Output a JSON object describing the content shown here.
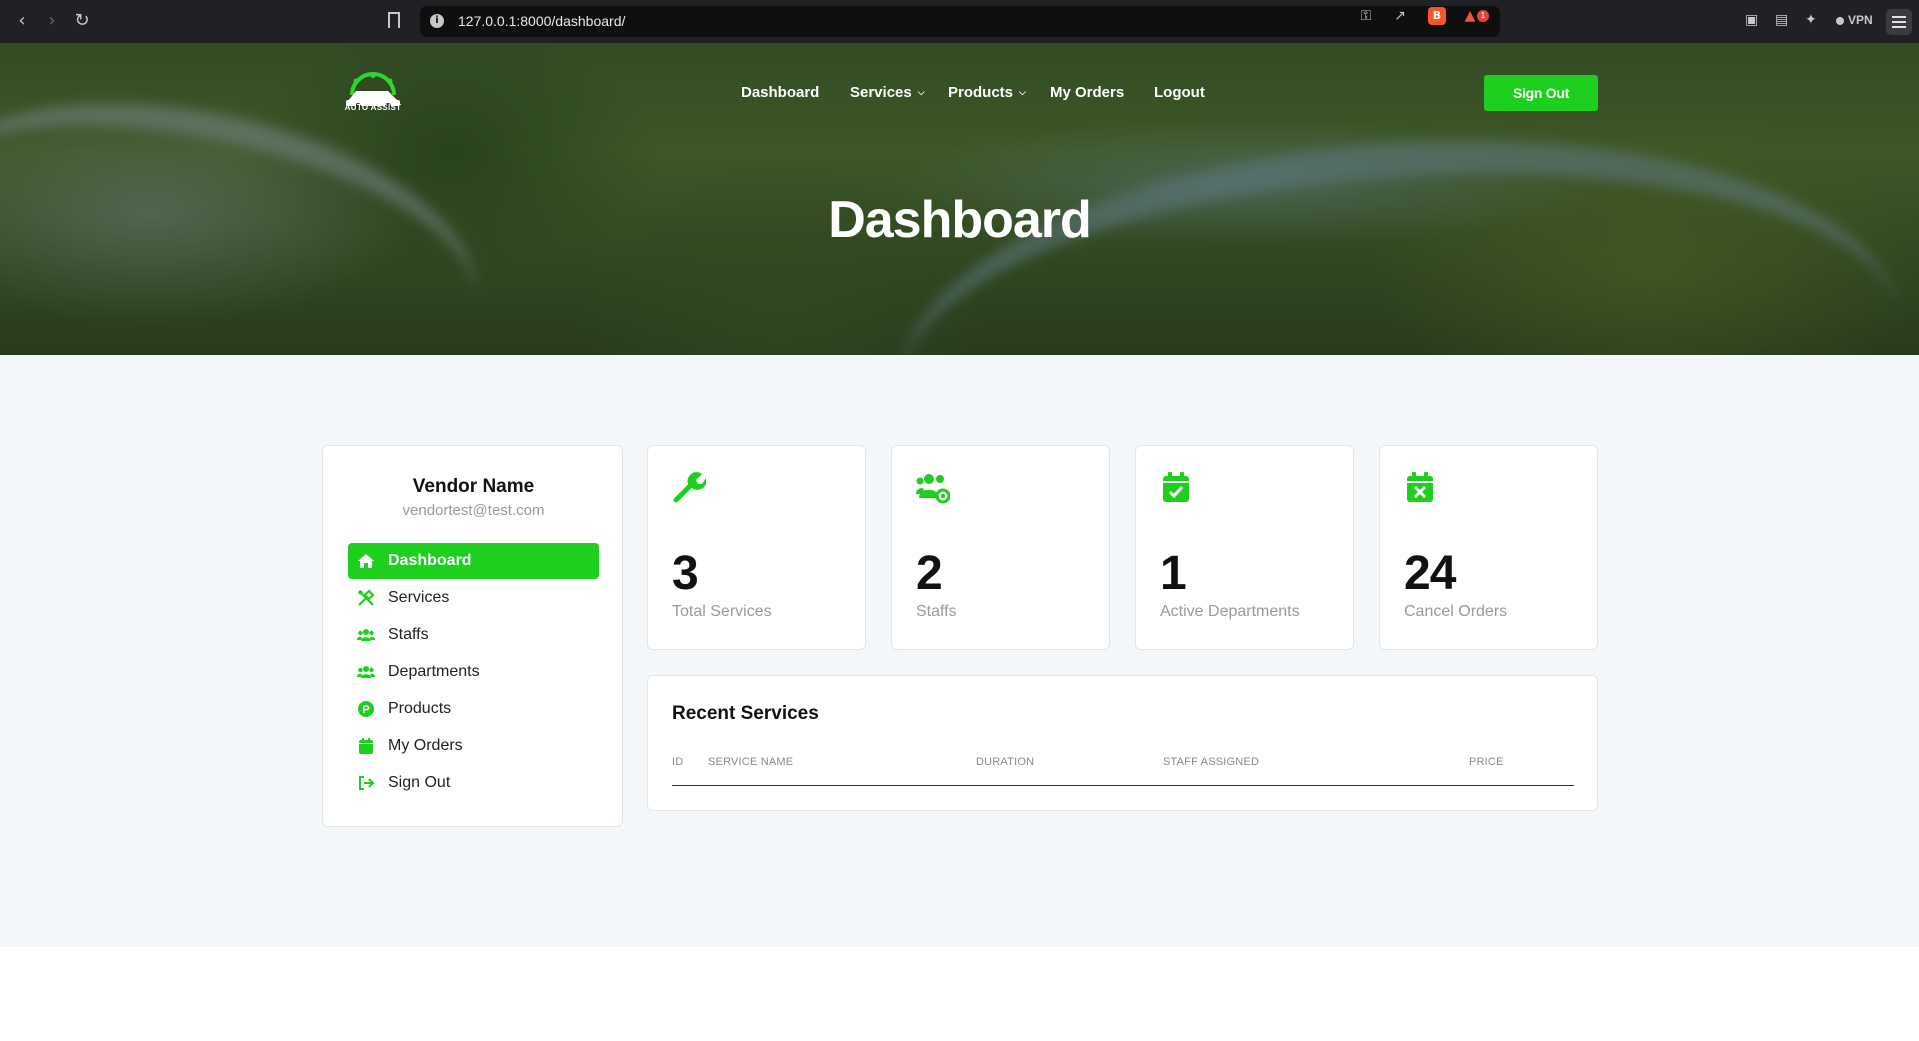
{
  "browser": {
    "url": "127.0.0.1:8000/dashboard/",
    "alert_count": "1",
    "vpn_label": "VPN"
  },
  "header": {
    "logo_text": "AUTO ASSIST",
    "nav": {
      "dashboard": "Dashboard",
      "services": "Services",
      "products": "Products",
      "my_orders": "My Orders",
      "logout": "Logout"
    },
    "signout_label": "Sign Out"
  },
  "hero": {
    "title": "Dashboard"
  },
  "profile": {
    "name": "Vendor Name",
    "email": "vendortest@test.com"
  },
  "sidebar": {
    "items": [
      {
        "label": "Dashboard",
        "icon": "home-icon",
        "active": true
      },
      {
        "label": "Services",
        "icon": "tools-icon",
        "active": false
      },
      {
        "label": "Staffs",
        "icon": "users-icon",
        "active": false
      },
      {
        "label": "Departments",
        "icon": "users-icon",
        "active": false
      },
      {
        "label": "Products",
        "icon": "product-icon",
        "active": false
      },
      {
        "label": "My Orders",
        "icon": "calendar-icon",
        "active": false
      },
      {
        "label": "Sign Out",
        "icon": "sign-out-icon",
        "active": false
      }
    ]
  },
  "stats": [
    {
      "value": "3",
      "label": "Total Services",
      "icon": "wrench-icon"
    },
    {
      "value": "2",
      "label": "Staffs",
      "icon": "users-gear-icon"
    },
    {
      "value": "1",
      "label": "Active Departments",
      "icon": "calendar-check-icon"
    },
    {
      "value": "24",
      "label": "Cancel Orders",
      "icon": "calendar-x-icon"
    }
  ],
  "recent_services": {
    "title": "Recent Services",
    "columns": [
      "ID",
      "SERVICE NAME",
      "DURATION",
      "STAFF ASSIGNED",
      "PRICE"
    ]
  },
  "colors": {
    "accent": "#1ed01e",
    "page_bg": "#f3f7f9",
    "card_border": "#e2e6ea"
  }
}
